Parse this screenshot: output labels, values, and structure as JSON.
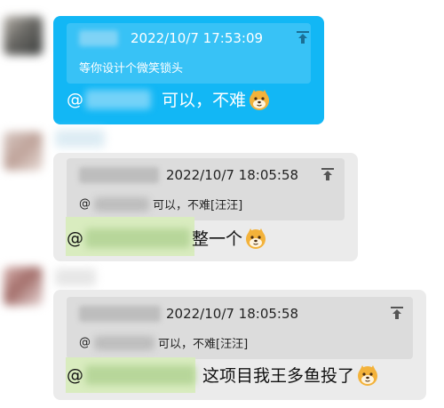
{
  "messages": [
    {
      "quote_time": "2022/10/7 17:53:09",
      "quote_text": "等你设计个微笑锁头",
      "at": "@",
      "text": "可以，不难"
    },
    {
      "quote_time": "2022/10/7 18:05:58",
      "quote_at": "@",
      "quote_text": "可以，不难[汪汪]",
      "at": "@",
      "text": "整一个"
    },
    {
      "quote_time": "2022/10/7 18:05:58",
      "quote_at": "@",
      "quote_text": "可以，不难[汪汪]",
      "at": "@",
      "text": "这项目我王多鱼投了"
    }
  ],
  "icons": {
    "jump": "jump-to-original-icon",
    "emoji": "shiba-dog-emoji-icon"
  },
  "colors": {
    "blue_bubble": "#12b7f5",
    "gray_bubble": "#ebebeb",
    "quote_gray": "#dcdcdc",
    "mention_highlight": "#d9ecbf"
  }
}
